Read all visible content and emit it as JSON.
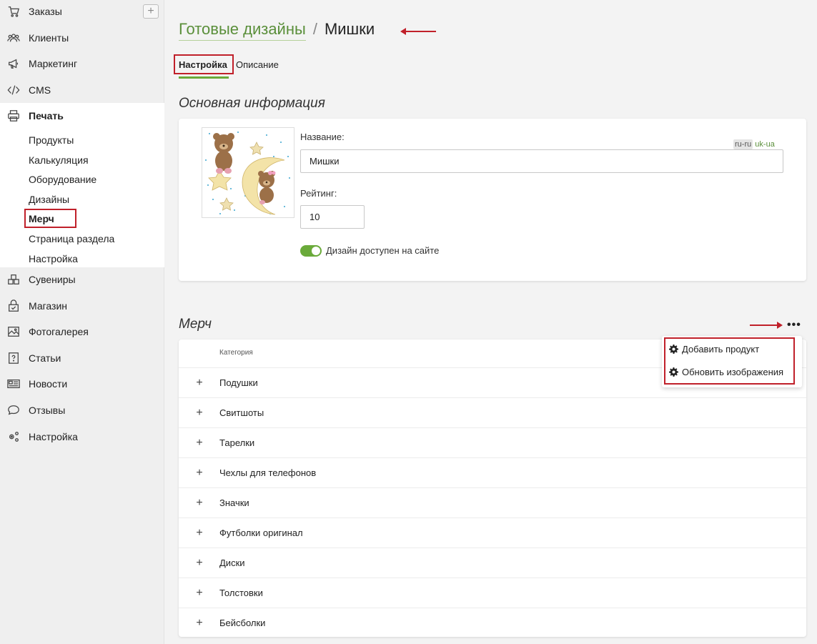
{
  "sidebar": {
    "items": [
      {
        "label": "Заказы",
        "icon": "cart-icon"
      },
      {
        "label": "Клиенты",
        "icon": "users-icon"
      },
      {
        "label": "Маркетинг",
        "icon": "megaphone-icon"
      },
      {
        "label": "CMS",
        "icon": "code-icon"
      },
      {
        "label": "Печать",
        "icon": "printer-icon"
      },
      {
        "label": "Сувениры",
        "icon": "boxes-icon"
      },
      {
        "label": "Магазин",
        "icon": "shop-icon"
      },
      {
        "label": "Фотогалерея",
        "icon": "image-icon"
      },
      {
        "label": "Статьи",
        "icon": "question-icon"
      },
      {
        "label": "Новости",
        "icon": "news-icon"
      },
      {
        "label": "Отзывы",
        "icon": "chat-icon"
      },
      {
        "label": "Настройка",
        "icon": "settings-icon"
      }
    ],
    "add_button": "+",
    "subitems": [
      "Продукты",
      "Калькуляция",
      "Оборудование",
      "Дизайны",
      "Мерч",
      "Страница раздела",
      "Настройка"
    ]
  },
  "breadcrumb": {
    "parent": "Готовые дизайны",
    "separator": "/",
    "current": "Мишки"
  },
  "tabs": {
    "settings": "Настройка",
    "description": "Описание"
  },
  "basic_info": {
    "title": "Основная информация",
    "name_label": "Название:",
    "name_value": "Мишки",
    "lang_active": "ru-ru",
    "lang_other": "uk-ua",
    "rating_label": "Рейтинг:",
    "rating_value": "10",
    "available_label": "Дизайн доступен на сайте",
    "available": true
  },
  "merch": {
    "title": "Мерч",
    "more_button": "•••",
    "column_header": "Категория",
    "rows": [
      "Подушки",
      "Свитшоты",
      "Тарелки",
      "Чехлы для телефонов",
      "Значки",
      "Футболки оригинал",
      "Диски",
      "Толстовки",
      "Бейсболки"
    ],
    "expand_symbol": "+",
    "menu": {
      "add_product": "Добавить продукт",
      "update_images": "Обновить изображения"
    }
  },
  "colors": {
    "accent": "#6aaa3a",
    "link": "#5a8f3a",
    "annotation": "#c0202a"
  }
}
